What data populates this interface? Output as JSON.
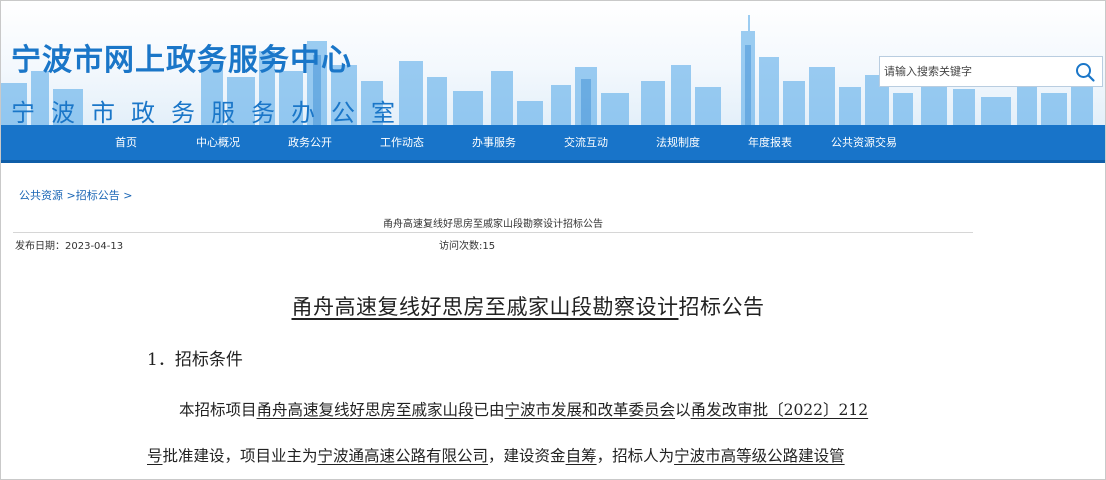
{
  "header": {
    "title": "宁波市网上政务服务中心",
    "subtitle": "宁波市政务服务办公室"
  },
  "search": {
    "placeholder": "请输入搜索关键字",
    "icon": "search-icon"
  },
  "colors": {
    "brand_blue": "#1874c9",
    "nav_bottom": "#0f5ea8",
    "link_blue": "#1a66b5",
    "skyline_blue": "#4fa6e8"
  },
  "nav": {
    "items": [
      {
        "label": "首页"
      },
      {
        "label": "中心概况"
      },
      {
        "label": "政务公开"
      },
      {
        "label": "工作动态"
      },
      {
        "label": "办事服务"
      },
      {
        "label": "交流互动"
      },
      {
        "label": "法规制度"
      },
      {
        "label": "年度报表"
      },
      {
        "label": "公共资源交易"
      }
    ]
  },
  "breadcrumb": {
    "item1": "公共资源",
    "sep": ">",
    "item2": "招标公告",
    "trail": ">"
  },
  "article": {
    "header_title": "甬舟高速复线好思房至戚家山段勘察设计招标公告",
    "publish_date": "发布日期：2023-04-13",
    "visits": "访问次数:15",
    "title_underlined": "甬舟高速复线好思房至戚家山段勘察设计",
    "title_tail": "招标公告",
    "section1": "1．招标条件",
    "p1": {
      "t1": "本招标项目",
      "u1": "甬舟高速复线好思房至戚家山段",
      "t2": "已由",
      "u2": "宁波市发展和改革委员会",
      "t3": "以",
      "u3": "甬发改审批〔2022〕212"
    },
    "p2": {
      "u1": "号",
      "t1": "批准建设，项目业主为",
      "u2": "宁波通高速公路有限公司",
      "t2": "，建设资金",
      "u3": "自筹",
      "t3": "，招标人为",
      "u4": "宁波市高等级公路建设管"
    }
  }
}
